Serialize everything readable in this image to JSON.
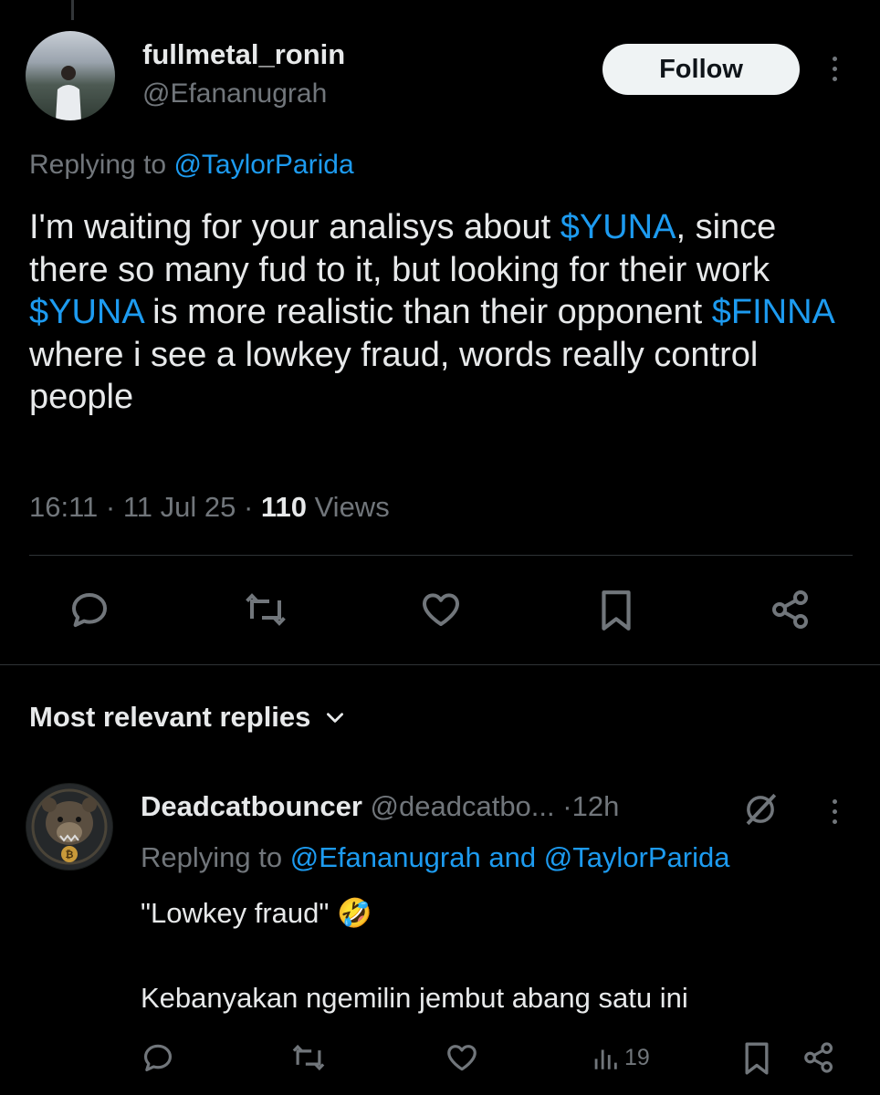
{
  "main_tweet": {
    "display_name": "fullmetal_ronin",
    "handle": "@Efananugrah",
    "follow_label": "Follow",
    "replying_prefix": "Replying to",
    "replying_to": "@TaylorParida",
    "text_segments": [
      {
        "text": "I'm waiting for your analisys about ",
        "link": false
      },
      {
        "text": "$YUNA",
        "link": true
      },
      {
        "text": ", since there so many fud to it, but looking for their work ",
        "link": false
      },
      {
        "text": "$YUNA",
        "link": true
      },
      {
        "text": " is more realistic than their opponent ",
        "link": false
      },
      {
        "text": "$FINNA",
        "link": true
      },
      {
        "text": " where i see a lowkey fraud, words really control people",
        "link": false
      }
    ],
    "time": "16:11",
    "date": "11 Jul 25",
    "views_count": "110",
    "views_label": "Views",
    "actions": [
      "reply-icon",
      "repost-icon",
      "like-icon",
      "bookmark-icon",
      "share-icon"
    ]
  },
  "replies_section": {
    "title": "Most relevant replies"
  },
  "reply": {
    "display_name": "Deadcatbouncer",
    "handle": "@deadcatbo...",
    "separator": "·",
    "time_ago": "12h",
    "replying_prefix": "Replying to",
    "replying_to_1": "@Efananugrah",
    "replying_and": "and",
    "replying_to_2": "@TaylorParida",
    "line1": "\"Lowkey fraud\"",
    "emoji": "🤣",
    "line2": "Kebanyakan ngemilin jembut abang satu ini",
    "views_count": "19",
    "colors": {
      "accent": "#1d9bf0",
      "muted": "#71767b",
      "text": "#e7e9ea",
      "background": "#000000"
    }
  }
}
